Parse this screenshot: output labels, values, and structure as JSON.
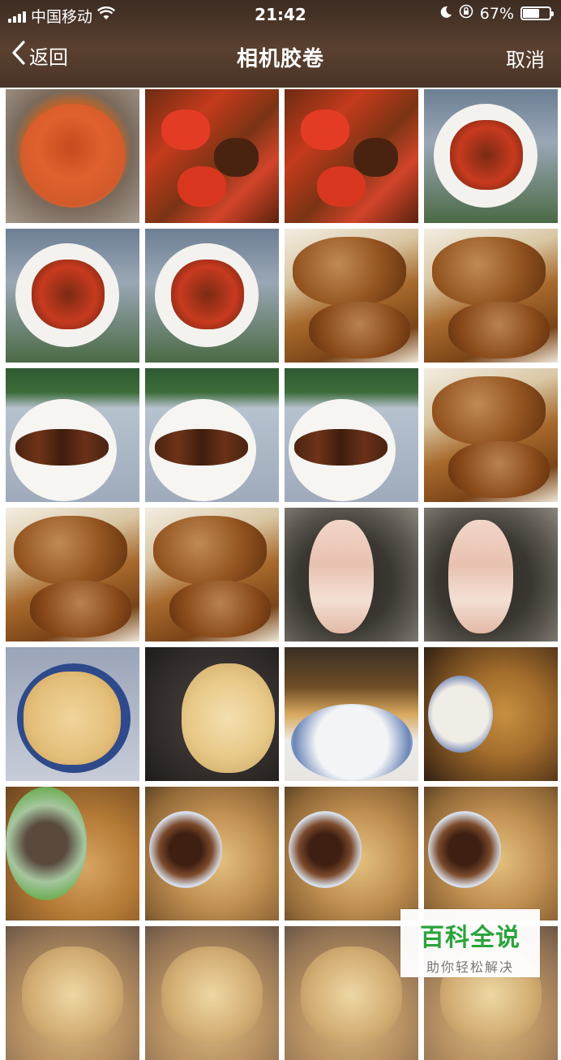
{
  "status_bar": {
    "carrier": "中国移动",
    "time": "21:42",
    "battery": "67%",
    "battery_level": 0.67
  },
  "nav": {
    "back_label": "返回",
    "title": "相机胶卷",
    "cancel_label": "取消"
  },
  "watermark": {
    "title": "百科全说",
    "subtitle": "助你轻松解决"
  },
  "photos": [
    {
      "kind": "tomato-pan"
    },
    {
      "kind": "tomato-meat"
    },
    {
      "kind": "tomato-meat"
    },
    {
      "kind": "plate-dish"
    },
    {
      "kind": "plate-dish"
    },
    {
      "kind": "plate-dish"
    },
    {
      "kind": "fried-chicken"
    },
    {
      "kind": "fried-chicken"
    },
    {
      "kind": "drumstick-plate"
    },
    {
      "kind": "drumstick-plate"
    },
    {
      "kind": "drumstick-plate"
    },
    {
      "kind": "fried-chicken"
    },
    {
      "kind": "fried-chicken"
    },
    {
      "kind": "fried-chicken"
    },
    {
      "kind": "raw-pan"
    },
    {
      "kind": "raw-pan"
    },
    {
      "kind": "tofu-bowl"
    },
    {
      "kind": "tofu-pan"
    },
    {
      "kind": "tofu-plate"
    },
    {
      "kind": "tofu-garlic"
    },
    {
      "kind": "tofu-spice"
    },
    {
      "kind": "tofu-sauce"
    },
    {
      "kind": "tofu-sauce"
    },
    {
      "kind": "tofu-sauce"
    },
    {
      "kind": "tofu-cook"
    },
    {
      "kind": "tofu-cook"
    },
    {
      "kind": "tofu-cook"
    },
    {
      "kind": "tofu-cook"
    }
  ]
}
